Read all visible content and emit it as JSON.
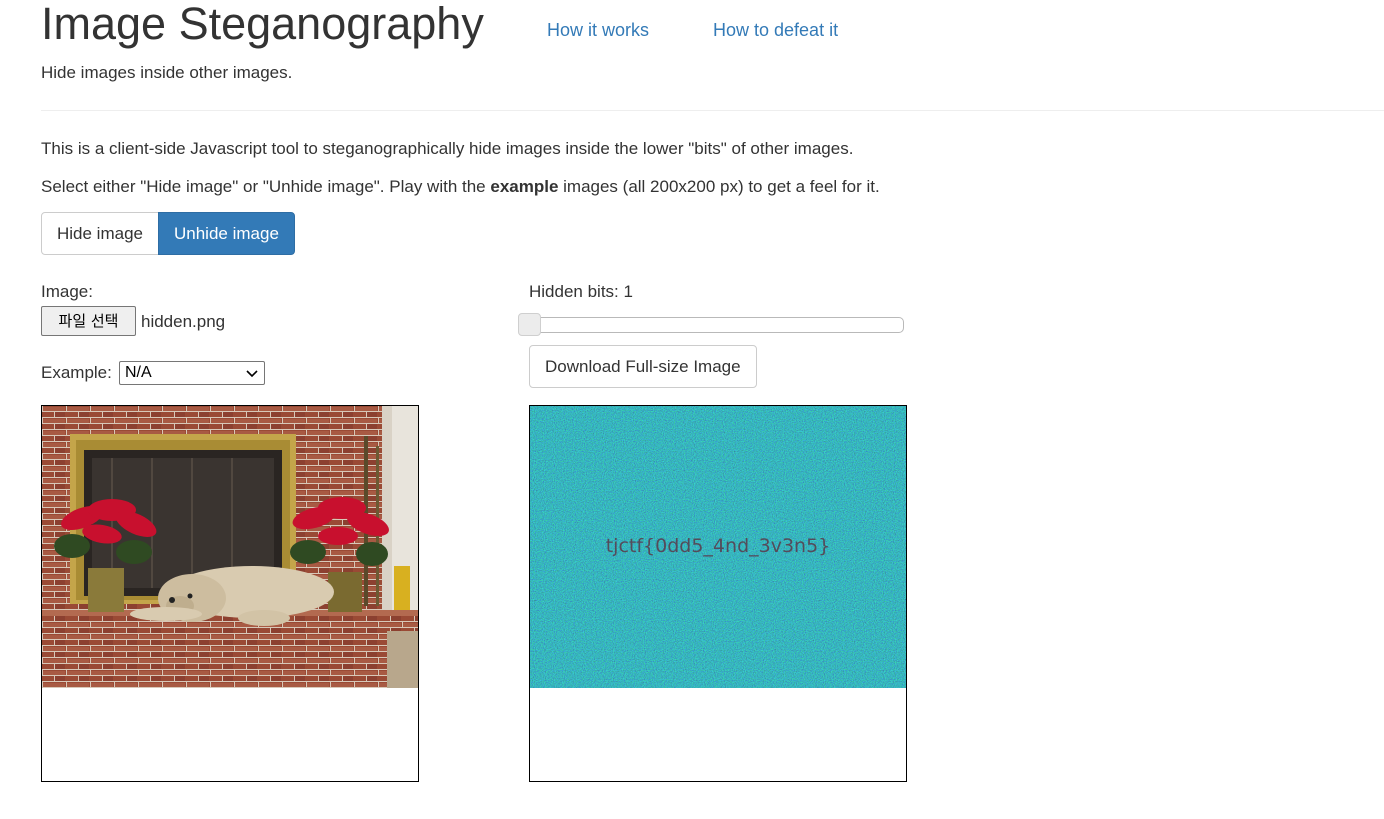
{
  "header": {
    "title": "Image Steganography",
    "nav": [
      "How it works",
      "How to defeat it"
    ],
    "subtitle": "Hide images inside other images."
  },
  "intro": {
    "line1": "This is a client-side Javascript tool to steganographically hide images inside the lower \"bits\" of other images.",
    "line2_before": "Select either \"Hide image\" or \"Unhide image\". Play with the ",
    "line2_bold": "example",
    "line2_after": " images (all 200x200 px) to get a feel for it."
  },
  "mode_buttons": {
    "hide_label": "Hide image",
    "unhide_label": "Unhide image",
    "active": "unhide"
  },
  "image_input": {
    "label": "Image:",
    "file_button": "파일 선택",
    "file_name": "hidden.png"
  },
  "example": {
    "label": "Example:",
    "selected": "N/A"
  },
  "hidden_bits": {
    "label": "Hidden bits: 1",
    "value": 1
  },
  "download_button": "Download Full-size Image",
  "revealed_text": "tjctf{0dd5_4nd_3v3n5}",
  "colors": {
    "accent": "#337ab7",
    "noise_bg": "#0d3a4a"
  }
}
